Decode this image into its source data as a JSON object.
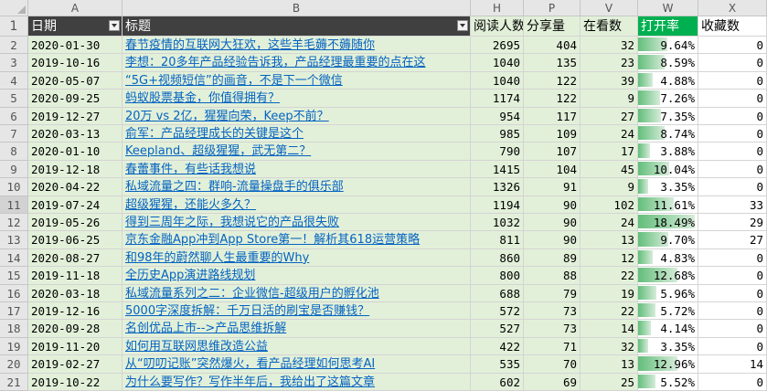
{
  "columns": [
    "A",
    "B",
    "H",
    "P",
    "V",
    "W",
    "X"
  ],
  "header": {
    "row_no": "1",
    "date": "日期",
    "title": "标题",
    "reads": "阅读人数",
    "shares": "分享量",
    "watching": "在看数",
    "open_rate": "打开率",
    "favorites": "收藏数"
  },
  "colors": {
    "header_dark": "#404040",
    "light_green": "#e2f0d9",
    "accent_green": "#00b050",
    "link": "#0563c1"
  },
  "rows": [
    {
      "no": "2",
      "date": "2020-01-30",
      "title": "春节疫情的互联网大狂欢，这些羊毛薅不薅随你",
      "reads": "2695",
      "shares": "404",
      "watching": "32",
      "open_rate": "9.64%",
      "rate_value": 9.64,
      "favorites": "0"
    },
    {
      "no": "3",
      "date": "2019-10-16",
      "title": "李想：20多年产品经验告诉我，产品经理最重要的点在这",
      "reads": "1040",
      "shares": "135",
      "watching": "23",
      "open_rate": "8.59%",
      "rate_value": 8.59,
      "favorites": "0"
    },
    {
      "no": "4",
      "date": "2020-05-07",
      "title": "“5G+视频短信”的画音，不是下一个微信",
      "reads": "1040",
      "shares": "122",
      "watching": "39",
      "open_rate": "4.88%",
      "rate_value": 4.88,
      "favorites": "0"
    },
    {
      "no": "5",
      "date": "2020-09-25",
      "title": "蚂蚁股票基金，你值得拥有？",
      "reads": "1174",
      "shares": "122",
      "watching": "9",
      "open_rate": "7.26%",
      "rate_value": 7.26,
      "favorites": "0"
    },
    {
      "no": "6",
      "date": "2019-12-27",
      "title": "20万 vs 2亿，猩猩向荣，Keep不前？",
      "reads": "954",
      "shares": "117",
      "watching": "27",
      "open_rate": "7.35%",
      "rate_value": 7.35,
      "favorites": "0"
    },
    {
      "no": "7",
      "date": "2020-03-13",
      "title": "俞军：产品经理成长的关键是这个",
      "reads": "985",
      "shares": "109",
      "watching": "24",
      "open_rate": "8.74%",
      "rate_value": 8.74,
      "favorites": "0"
    },
    {
      "no": "8",
      "date": "2020-01-10",
      "title": "Keepland、超级猩猩，武无第二？",
      "reads": "790",
      "shares": "107",
      "watching": "17",
      "open_rate": "3.88%",
      "rate_value": 3.88,
      "favorites": "0"
    },
    {
      "no": "9",
      "date": "2019-12-18",
      "title": "春蕾事件，有些话我想说",
      "reads": "1415",
      "shares": "104",
      "watching": "45",
      "open_rate": "10.04%",
      "rate_value": 10.04,
      "favorites": "0"
    },
    {
      "no": "10",
      "date": "2020-04-22",
      "title": "私域流量之四：群响-流量操盘手的俱乐部",
      "reads": "1326",
      "shares": "91",
      "watching": "9",
      "open_rate": "3.35%",
      "rate_value": 3.35,
      "favorites": "0"
    },
    {
      "no": "11",
      "date": "2019-07-24",
      "title": "超级猩猩，还能火多久？",
      "reads": "1194",
      "shares": "90",
      "watching": "102",
      "open_rate": "11.61%",
      "rate_value": 11.61,
      "favorites": "33"
    },
    {
      "no": "12",
      "date": "2019-05-26",
      "title": "得到三周年之际，我想说它的产品很失败",
      "reads": "1032",
      "shares": "90",
      "watching": "24",
      "open_rate": "18.49%",
      "rate_value": 18.49,
      "favorites": "29"
    },
    {
      "no": "13",
      "date": "2019-06-25",
      "title": "京东金融App冲到App Store第一！解析其618运营策略",
      "reads": "811",
      "shares": "90",
      "watching": "13",
      "open_rate": "9.70%",
      "rate_value": 9.7,
      "favorites": "27"
    },
    {
      "no": "14",
      "date": "2020-08-27",
      "title": "和98年的蔚然聊人生最重要的Why",
      "reads": "860",
      "shares": "89",
      "watching": "12",
      "open_rate": "4.83%",
      "rate_value": 4.83,
      "favorites": "0"
    },
    {
      "no": "15",
      "date": "2019-11-18",
      "title": "全历史App演进路线规划",
      "reads": "800",
      "shares": "88",
      "watching": "22",
      "open_rate": "12.68%",
      "rate_value": 12.68,
      "favorites": "0"
    },
    {
      "no": "16",
      "date": "2020-03-18",
      "title": "私域流量系列之二：企业微信-超级用户的孵化池",
      "reads": "688",
      "shares": "79",
      "watching": "19",
      "open_rate": "5.96%",
      "rate_value": 5.96,
      "favorites": "0"
    },
    {
      "no": "17",
      "date": "2019-12-16",
      "title": "5000字深度拆解：千万日活的刷宝是否赚钱？",
      "reads": "572",
      "shares": "73",
      "watching": "22",
      "open_rate": "5.72%",
      "rate_value": 5.72,
      "favorites": "0"
    },
    {
      "no": "18",
      "date": "2020-09-28",
      "title": "名创优品上市-->产品思维拆解",
      "reads": "527",
      "shares": "73",
      "watching": "14",
      "open_rate": "4.14%",
      "rate_value": 4.14,
      "favorites": "0"
    },
    {
      "no": "19",
      "date": "2019-11-20",
      "title": "如何用互联网思维改造公益",
      "reads": "422",
      "shares": "71",
      "watching": "32",
      "open_rate": "3.35%",
      "rate_value": 3.35,
      "favorites": "0"
    },
    {
      "no": "20",
      "date": "2019-02-27",
      "title": "从“叨叨记账”突然爆火，看产品经理如何思考AI",
      "reads": "535",
      "shares": "70",
      "watching": "13",
      "open_rate": "12.96%",
      "rate_value": 12.96,
      "favorites": "14"
    },
    {
      "no": "21",
      "date": "2019-10-22",
      "title": "为什么要写作？写作半年后，我给出了这篇文章",
      "reads": "602",
      "shares": "69",
      "watching": "25",
      "open_rate": "5.52%",
      "rate_value": 5.52,
      "favorites": "0"
    }
  ],
  "selected_row": "11"
}
